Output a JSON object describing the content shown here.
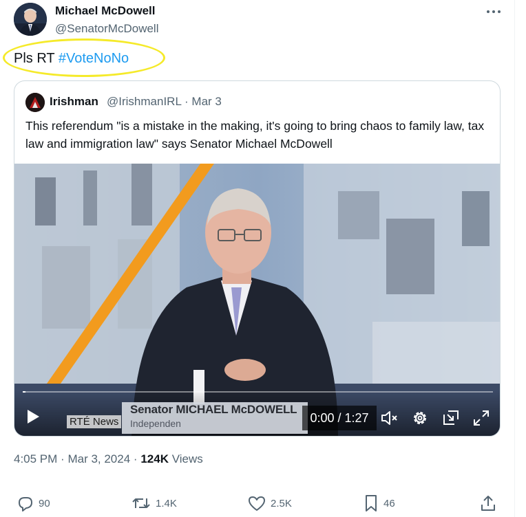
{
  "author": {
    "name": "Michael McDowell",
    "handle": "@SenatorMcDowell",
    "avatar_icon": "person-avatar"
  },
  "menu": {
    "more_icon": "more-horizontal-icon"
  },
  "tweet": {
    "text_plain": "Pls RT ",
    "hashtag": "#VoteNoNo",
    "annotation_color": "#f5ea2a"
  },
  "quote": {
    "name": "Irishman",
    "handle": "@IrishmanIRL",
    "separator": "·",
    "date": "Mar 3",
    "text": "This referendum \"is a mistake in the making, it's going to bring chaos to family law, tax law and immigration law\" says Senator Michael McDowell"
  },
  "video": {
    "broadcaster": "RTÉ News",
    "lower_third_name": "Senator MICHAEL McDOWELL",
    "lower_third_role": "Independen",
    "time": "0:00 / 1:27",
    "progress": 0.0
  },
  "meta": {
    "time": "4:05 PM",
    "sep": "·",
    "date": "Mar 3, 2024",
    "views_count": "124K",
    "views_label": "Views"
  },
  "actions": {
    "replies": "90",
    "reposts": "1.4K",
    "likes": "2.5K",
    "bookmarks": "46"
  },
  "colors": {
    "link": "#1d9bf0",
    "secondary_text": "#536471",
    "primary_text": "#0f1419",
    "border": "#cfd9de"
  }
}
